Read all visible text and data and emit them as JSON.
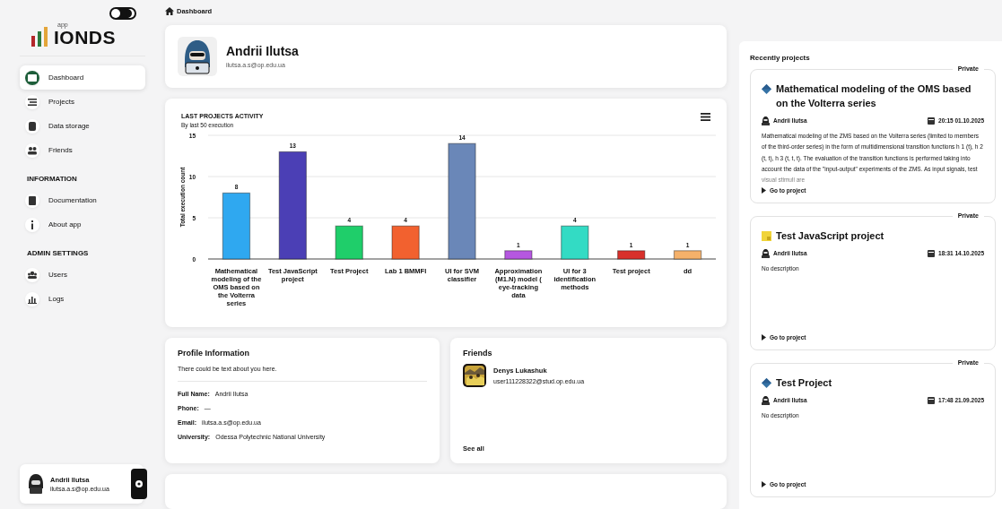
{
  "sidebar": {
    "logo": {
      "small": "app",
      "name": "IONDS"
    },
    "theme_dark": true,
    "sections": [
      {
        "items": [
          {
            "label": "Dashboard",
            "selected": true
          },
          {
            "label": "Projects",
            "selected": false
          },
          {
            "label": "Data storage",
            "selected": false
          },
          {
            "label": "Friends",
            "selected": false
          }
        ]
      },
      {
        "title": "INFORMATION",
        "items": [
          {
            "label": "Documentation",
            "selected": false
          },
          {
            "label": "About app",
            "selected": false
          }
        ]
      },
      {
        "title": "ADMIN SETTINGS",
        "items": [
          {
            "label": "Users",
            "selected": false
          },
          {
            "label": "Logs",
            "selected": false
          }
        ]
      }
    ],
    "user": {
      "name": "Andrii Ilutsa",
      "email": "ilutsa.a.s@op.edu.ua"
    }
  },
  "breadcrumb": "Dashboard",
  "profile_header": {
    "name": "Andrii Ilutsa",
    "email": "ilutsa.a.s@op.edu.ua"
  },
  "activity": {
    "chart_data": {
      "type": "bar",
      "title": "LAST PROJECTS ACTIVITY",
      "subtitle": "By last 50 execution",
      "ylabel": "Total execution count",
      "categories": [
        "Mathematical modeling of the OMS based on the Volterra series",
        "Test JavaScript project",
        "Test Project",
        "Lab 1 BMMFI",
        "UI for SVM classifier",
        "Approximation (M1.N) model ( eye-tracking data",
        "UI for 3 identification methods",
        "Test project",
        "dd"
      ],
      "values": [
        8,
        13,
        4,
        4,
        14,
        1,
        4,
        1,
        1
      ],
      "colors": [
        "#2fa8f0",
        "#4b3fb5",
        "#1fce6a",
        "#f2612f",
        "#6a87b8",
        "#b557e0",
        "#33dbc4",
        "#d8302b",
        "#f5b16a"
      ],
      "ylim": [
        0,
        15
      ],
      "yticks": [
        0,
        5,
        10,
        15
      ],
      "data_labels": true
    }
  },
  "profile_info": {
    "title": "Profile Information",
    "about": "There could be text about you here.",
    "fields": [
      {
        "label": "Full Name:",
        "value": "Andrii Ilutsa"
      },
      {
        "label": "Phone:",
        "value": "—"
      },
      {
        "label": "Email:",
        "value": "ilutsa.a.s@op.edu.ua"
      },
      {
        "label": "University:",
        "value": "Odessa Polytechnic National University"
      }
    ]
  },
  "friends": {
    "title": "Friends",
    "items": [
      {
        "name": "Denys Lukashuk",
        "email": "user111228322@stud.op.edu.ua"
      }
    ],
    "see_all": "See all"
  },
  "recent": {
    "title": "Recently projects",
    "projects": [
      {
        "visibility": "Private",
        "kind": "python",
        "title": "Mathematical modeling of the OMS based on the Volterra series",
        "author": "Andrii Ilutsa",
        "datetime": "20:15 01.10.2025",
        "description": "Mathematical modeling of the ZMS based on the Volterra series (limited to members of the third-order series) in the form of multidimensional transition functions h 1 (t), h 2 (t, t), h 3 (t, t, t). The evaluation of the transition functions is performed taking into account the data of the \"input-output\" experiments of the ZMS. As input signals, test visual stimuli are",
        "link": "Go to project"
      },
      {
        "visibility": "Private",
        "kind": "javascript",
        "title": "Test JavaScript project",
        "author": "Andrii Ilutsa",
        "datetime": "18:31 14.10.2025",
        "description": "No description",
        "link": "Go to project"
      },
      {
        "visibility": "Private",
        "kind": "python",
        "title": "Test Project",
        "author": "Andrii Ilutsa",
        "datetime": "17:48 21.09.2025",
        "description": "No description",
        "link": "Go to project"
      }
    ]
  }
}
